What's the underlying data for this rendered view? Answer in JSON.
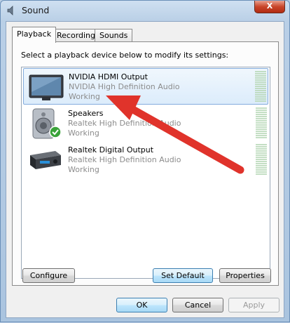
{
  "window": {
    "title": "Sound",
    "close_label": "X"
  },
  "tabs": [
    {
      "label": "Playback",
      "active": true
    },
    {
      "label": "Recording",
      "active": false
    },
    {
      "label": "Sounds",
      "active": false
    }
  ],
  "instruction": "Select a playback device below to modify its settings:",
  "devices": [
    {
      "name": "NVIDIA HDMI Output",
      "description": "NVIDIA High Definition Audio",
      "status": "Working",
      "icon": "monitor-icon",
      "selected": true,
      "is_default": false
    },
    {
      "name": "Speakers",
      "description": "Realtek High Definition Audio",
      "status": "Working",
      "icon": "speaker-icon",
      "selected": false,
      "is_default": true
    },
    {
      "name": "Realtek Digital Output",
      "description": "Realtek High Definition Audio",
      "status": "Working",
      "icon": "digital-output-icon",
      "selected": false,
      "is_default": false
    }
  ],
  "panel_buttons": {
    "configure": "Configure",
    "set_default": "Set Default",
    "properties": "Properties"
  },
  "dialog_buttons": {
    "ok": "OK",
    "cancel": "Cancel",
    "apply": "Apply"
  },
  "colors": {
    "selection_border": "#84acdd",
    "annotation_arrow": "#e0332b",
    "default_check": "#3aa33a"
  }
}
